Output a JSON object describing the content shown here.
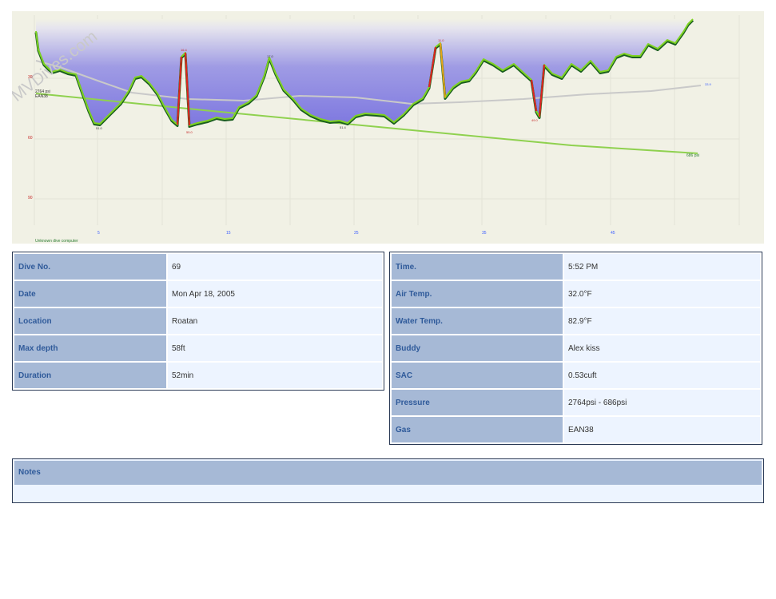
{
  "profile": {
    "watermark": "MVDives.com",
    "computer_label": "Unknown dive computer",
    "start_pressure": "2764 psi",
    "end_pressure": "686 psi",
    "gas_label": "EAN38",
    "depth_ticks": [
      "30",
      "60",
      "90"
    ],
    "time_ticks": [
      "5",
      "15",
      "25",
      "35",
      "45"
    ],
    "right_scale_label": "33.9",
    "peak_labels": [
      "51.0",
      "16.4",
      "55.0",
      "17.0",
      "51.4",
      "11.0",
      "49.0"
    ],
    "colors": {
      "bg": "#f1f1e5",
      "gradient_top": "#7e78e0",
      "gradient_bottom": "#efeee2",
      "depth_line": "#7ed321",
      "fast_ascent": "#e02020",
      "medium_ascent": "#e8a317",
      "descent": "#1b5e20",
      "pressure_line": "#8fd14f",
      "temp_line": "#c8c8c8"
    }
  },
  "left_table": [
    {
      "label": "Dive No.",
      "value": "69"
    },
    {
      "label": "Date",
      "value": "Mon Apr 18, 2005"
    },
    {
      "label": "Location",
      "value": "Roatan"
    },
    {
      "label": "Max depth",
      "value": "58ft"
    },
    {
      "label": "Duration",
      "value": "52min"
    }
  ],
  "right_table": [
    {
      "label": "Time.",
      "value": "5:52 PM"
    },
    {
      "label": "Air Temp.",
      "value": "32.0°F"
    },
    {
      "label": "Water Temp.",
      "value": "82.9°F"
    },
    {
      "label": "Buddy",
      "value": "Alex kiss"
    },
    {
      "label": "SAC",
      "value": "0.53cuft"
    },
    {
      "label": "Pressure",
      "value": "2764psi - 686psi"
    },
    {
      "label": "Gas",
      "value": "EAN38"
    }
  ],
  "notes": {
    "label": "Notes",
    "text": ""
  }
}
